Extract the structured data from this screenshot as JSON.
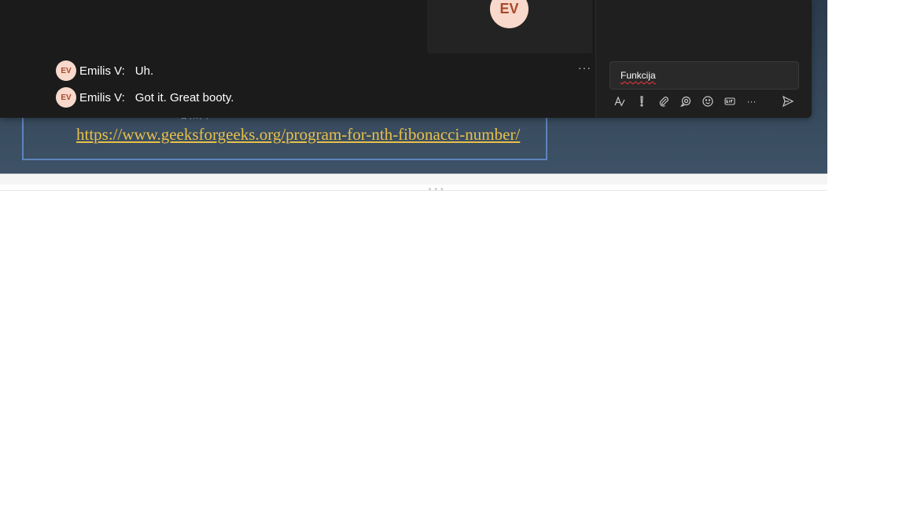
{
  "slide": {
    "link": "https://www.geeksforgeeks.org/program-for-nth-fibonacci-number/",
    "faint_text": "g (n) )"
  },
  "video": {
    "avatar_initials": "EV"
  },
  "captions": [
    {
      "initials": "EV",
      "speaker": "Emilis V:",
      "text": "Uh."
    },
    {
      "initials": "EV",
      "speaker": "Emilis V:",
      "text": "Got it. Great booty."
    }
  ],
  "captions_more": "···",
  "chat": {
    "input_value": "Funkcija",
    "toolbar": [
      "format-icon",
      "priority-icon",
      "attach-icon",
      "loop-icon",
      "emoji-icon",
      "gif-icon",
      "more-icon"
    ],
    "more_label": "···"
  },
  "splitter_grip": "• • •",
  "colors": {
    "link": "#e8c04a",
    "avatar_bg": "#f8d9cc",
    "avatar_text": "#a8492b",
    "slide_border": "#5e84bd"
  }
}
